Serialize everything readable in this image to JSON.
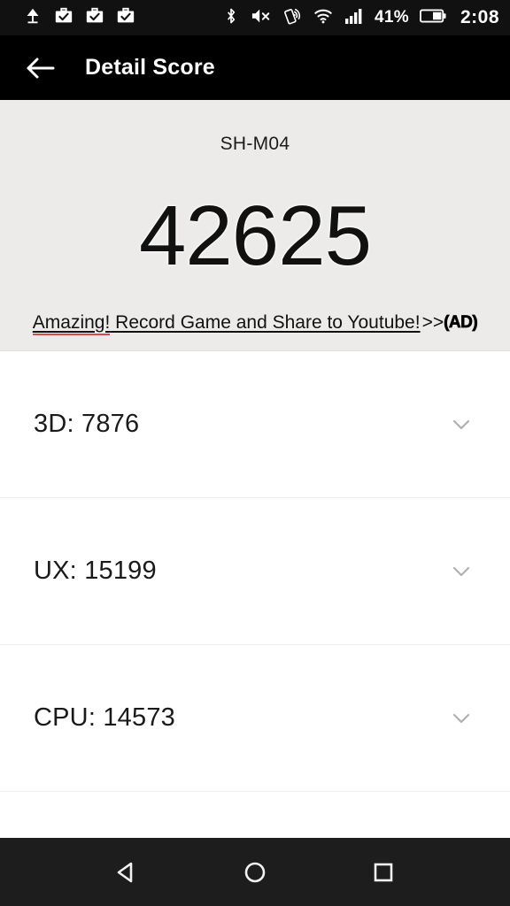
{
  "statusbar": {
    "left_icons": [
      {
        "name": "lamp-icon",
        "label": "lamp"
      },
      {
        "name": "briefcase-check-icon-1",
        "label": "work-app-installed"
      },
      {
        "name": "briefcase-check-icon-2",
        "label": "work-app-installed"
      },
      {
        "name": "briefcase-check-icon-3",
        "label": "work-app-installed"
      }
    ],
    "right_icons": [
      {
        "name": "bluetooth-icon",
        "label": "bluetooth"
      },
      {
        "name": "volume-mute-icon",
        "label": "sound-muted"
      },
      {
        "name": "nfc-icon",
        "label": "nfc"
      },
      {
        "name": "wifi-icon",
        "label": "wifi"
      },
      {
        "name": "cellular-signal-icon",
        "label": "signal"
      }
    ],
    "battery_percent": "41%",
    "clock": "2:08"
  },
  "appbar": {
    "back_label": "back-arrow",
    "title": "Detail Score"
  },
  "summary": {
    "device_name": "SH-M04",
    "total_score": "42625",
    "ad": {
      "misspelled_word": "Amazing!",
      "rest_text": " Record Game and Share to Youtube!",
      "arrows": ">>",
      "badge": "(AD)"
    }
  },
  "detail_rows": [
    {
      "label": "3D: 7876",
      "metric": "3D",
      "value": "7876"
    },
    {
      "label": "UX: 15199",
      "metric": "UX",
      "value": "15199"
    },
    {
      "label": "CPU: 14573",
      "metric": "CPU",
      "value": "14573"
    }
  ],
  "navbar": {
    "back": "nav-back",
    "home": "nav-home",
    "recents": "nav-recents"
  },
  "colors": {
    "statusbar_bg": "#111111",
    "appbar_bg": "#000000",
    "summary_bg": "#ECEBE9",
    "row_bg": "#ffffff",
    "navbar_bg": "#1d1d1d",
    "misspell_underline": "#d94b4b"
  }
}
